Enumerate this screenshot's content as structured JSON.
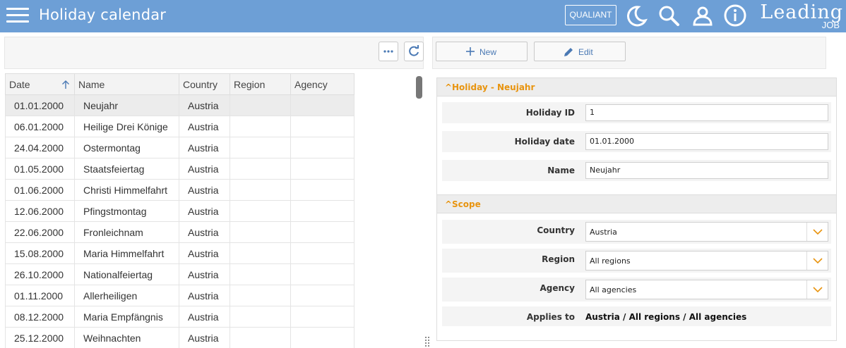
{
  "header": {
    "title": "Holiday calendar",
    "qualiant_label": "QUALIANT",
    "brand_main": "Leading",
    "brand_sub": "JOB",
    "icons": [
      "menu-icon",
      "moon-icon",
      "search-icon",
      "user-icon",
      "info-icon"
    ]
  },
  "grid": {
    "columns": [
      "Date",
      "Name",
      "Country",
      "Region",
      "Agency"
    ],
    "rows": [
      {
        "date": "01.01.2000",
        "name": "Neujahr",
        "country": "Austria",
        "region": "",
        "agency": ""
      },
      {
        "date": "06.01.2000",
        "name": "Heilige Drei Könige",
        "country": "Austria",
        "region": "",
        "agency": ""
      },
      {
        "date": "24.04.2000",
        "name": "Ostermontag",
        "country": "Austria",
        "region": "",
        "agency": ""
      },
      {
        "date": "01.05.2000",
        "name": "Staatsfeiertag",
        "country": "Austria",
        "region": "",
        "agency": ""
      },
      {
        "date": "01.06.2000",
        "name": "Christi Himmelfahrt",
        "country": "Austria",
        "region": "",
        "agency": ""
      },
      {
        "date": "12.06.2000",
        "name": "Pfingstmontag",
        "country": "Austria",
        "region": "",
        "agency": ""
      },
      {
        "date": "22.06.2000",
        "name": "Fronleichnam",
        "country": "Austria",
        "region": "",
        "agency": ""
      },
      {
        "date": "15.08.2000",
        "name": "Maria Himmelfahrt",
        "country": "Austria",
        "region": "",
        "agency": ""
      },
      {
        "date": "26.10.2000",
        "name": "Nationalfeiertag",
        "country": "Austria",
        "region": "",
        "agency": ""
      },
      {
        "date": "01.11.2000",
        "name": "Allerheiligen",
        "country": "Austria",
        "region": "",
        "agency": ""
      },
      {
        "date": "08.12.2000",
        "name": "Maria Empfängnis",
        "country": "Austria",
        "region": "",
        "agency": ""
      },
      {
        "date": "25.12.2000",
        "name": "Weihnachten",
        "country": "Austria",
        "region": "",
        "agency": ""
      }
    ],
    "selected_index": 0
  },
  "actions": {
    "new_label": "New",
    "edit_label": "Edit"
  },
  "holiday_section": {
    "title": "Holiday - Neujahr",
    "fields": {
      "id_label": "Holiday ID",
      "id_value": "1",
      "date_label": "Holiday date",
      "date_value": "01.01.2000",
      "name_label": "Name",
      "name_value": "Neujahr"
    }
  },
  "scope_section": {
    "title": "Scope",
    "country_label": "Country",
    "country_value": "Austria",
    "region_label": "Region",
    "region_value": "All regions",
    "agency_label": "Agency",
    "agency_value": "All agencies",
    "applies_label": "Applies to",
    "applies_value": "Austria / All regions / All agencies"
  },
  "colors": {
    "header_bg": "#6d9fd6",
    "section_accent": "#e8940f",
    "button_text": "#4a79b4"
  }
}
